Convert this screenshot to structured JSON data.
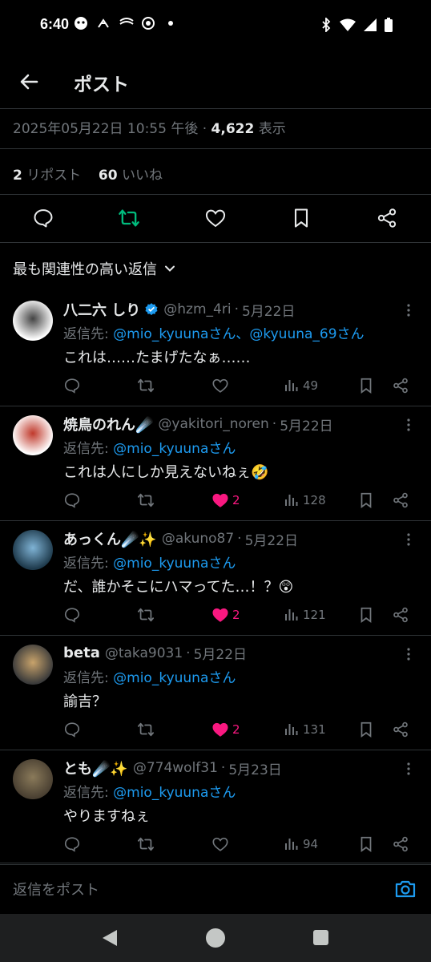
{
  "status_bar": {
    "time": "6:40"
  },
  "header": {
    "title": "ポスト"
  },
  "post_meta": {
    "datetime": "2025年05月22日 10:55 午後",
    "separator": "·",
    "views_count": "4,622",
    "views_label": "表示"
  },
  "stats": {
    "reposts_count": "2",
    "reposts_label": "リポスト",
    "likes_count": "60",
    "likes_label": "いいね"
  },
  "sort": {
    "label": "最も関連性の高い返信"
  },
  "replies": [
    {
      "name": "八二六 しり",
      "handle": "@hzm_4ri",
      "date": "5月22日",
      "verified": true,
      "reply_to_label": "返信先: ",
      "reply_to": "@mio_kyuunaさん、@kyuuna_69さん",
      "text": "これは……たまげたなぁ……",
      "likes": "",
      "views": "49",
      "liked": false
    },
    {
      "name": "焼鳥のれん☄️",
      "handle": "@yakitori_noren",
      "date": "5月22日",
      "verified": false,
      "reply_to_label": "返信先: ",
      "reply_to": "@mio_kyuunaさん",
      "text": "これは人にしか見えないねぇ🤣",
      "likes": "2",
      "views": "128",
      "liked": true
    },
    {
      "name": "あっくん☄️✨",
      "handle": "@akuno87",
      "date": "5月22日",
      "verified": false,
      "reply_to_label": "返信先: ",
      "reply_to": "@mio_kyuunaさん",
      "text": "だ、誰かそこにハマってた…！？😲",
      "likes": "2",
      "views": "121",
      "liked": true
    },
    {
      "name": "beta",
      "handle": "@taka9031",
      "date": "5月22日",
      "verified": false,
      "reply_to_label": "返信先: ",
      "reply_to": "@mio_kyuunaさん",
      "text": "諭吉？",
      "likes": "2",
      "views": "131",
      "liked": true
    },
    {
      "name": "とも☄️✨",
      "handle": "@774wolf31",
      "date": "5月23日",
      "verified": false,
      "reply_to_label": "返信先: ",
      "reply_to": "@mio_kyuunaさん",
      "text": "やりますねぇ",
      "likes": "",
      "views": "94",
      "liked": false
    }
  ],
  "composer": {
    "placeholder": "返信をポスト"
  },
  "colors": {
    "background": "#000000",
    "accent": "#1d9bf0",
    "like": "#f91880",
    "repost_active": "#00ba7c",
    "muted": "#71767b",
    "divider": "#2f3336"
  }
}
